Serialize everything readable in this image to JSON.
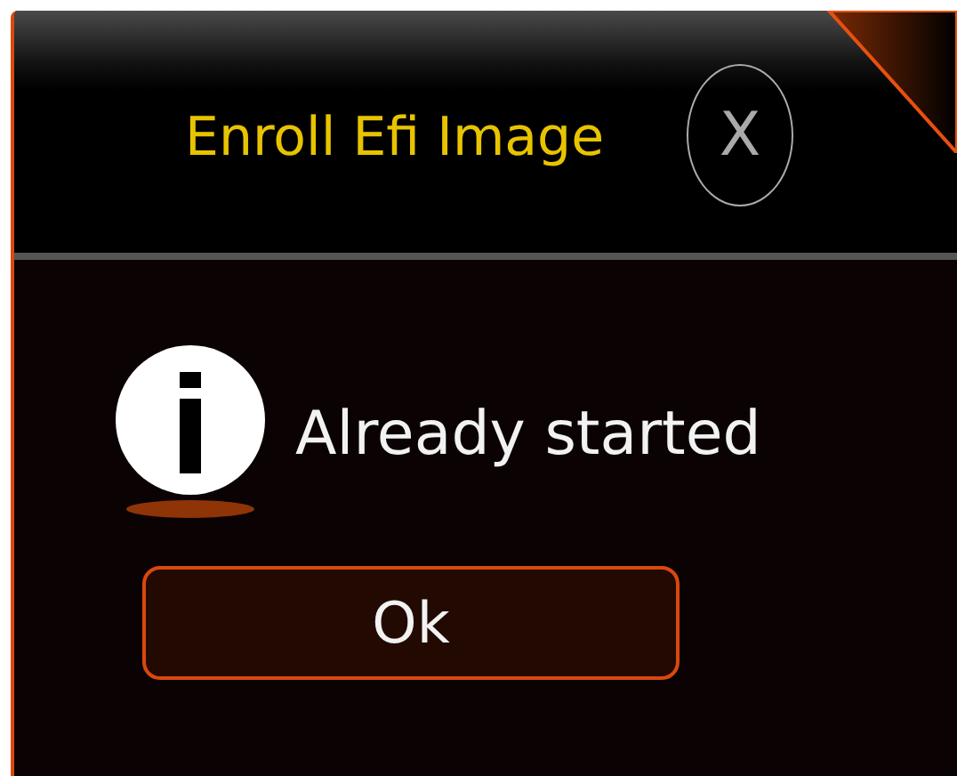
{
  "dialog": {
    "title": "Enroll Efi Image",
    "close_label": "X",
    "message": "Already started",
    "buttons": [
      "Ok"
    ]
  }
}
